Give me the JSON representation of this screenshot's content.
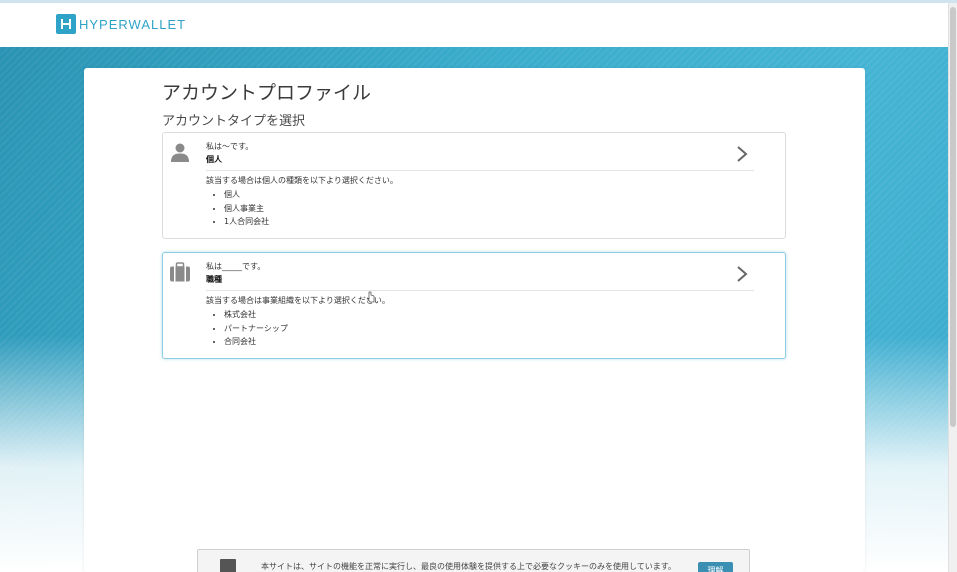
{
  "header": {
    "logo_text": "HYPERWALLET"
  },
  "page": {
    "title": "アカウントプロファイル",
    "subtitle": "アカウントタイプを選択"
  },
  "options": [
    {
      "lead": "私は～です。",
      "type": "個人",
      "description": "該当する場合は個人の種類を以下より選択ください。",
      "items": [
        "個人",
        "個人事業主",
        "1人合同会社"
      ],
      "icon": "person-icon"
    },
    {
      "lead": "私は_____です。",
      "type": "職種",
      "description": "該当する場合は事業組織を以下より選択ください。",
      "items": [
        "株式会社",
        "パートナーシップ",
        "合同会社"
      ],
      "icon": "briefcase-icon"
    }
  ],
  "cookie": {
    "text": "本サイトは、サイトの機能を正常に実行し、最良の使用体験を提供する上で必要なクッキーのみを使用しています。",
    "button_label": "理解"
  },
  "colors": {
    "brand": "#2fa3c7",
    "background": "#3aaccc"
  }
}
